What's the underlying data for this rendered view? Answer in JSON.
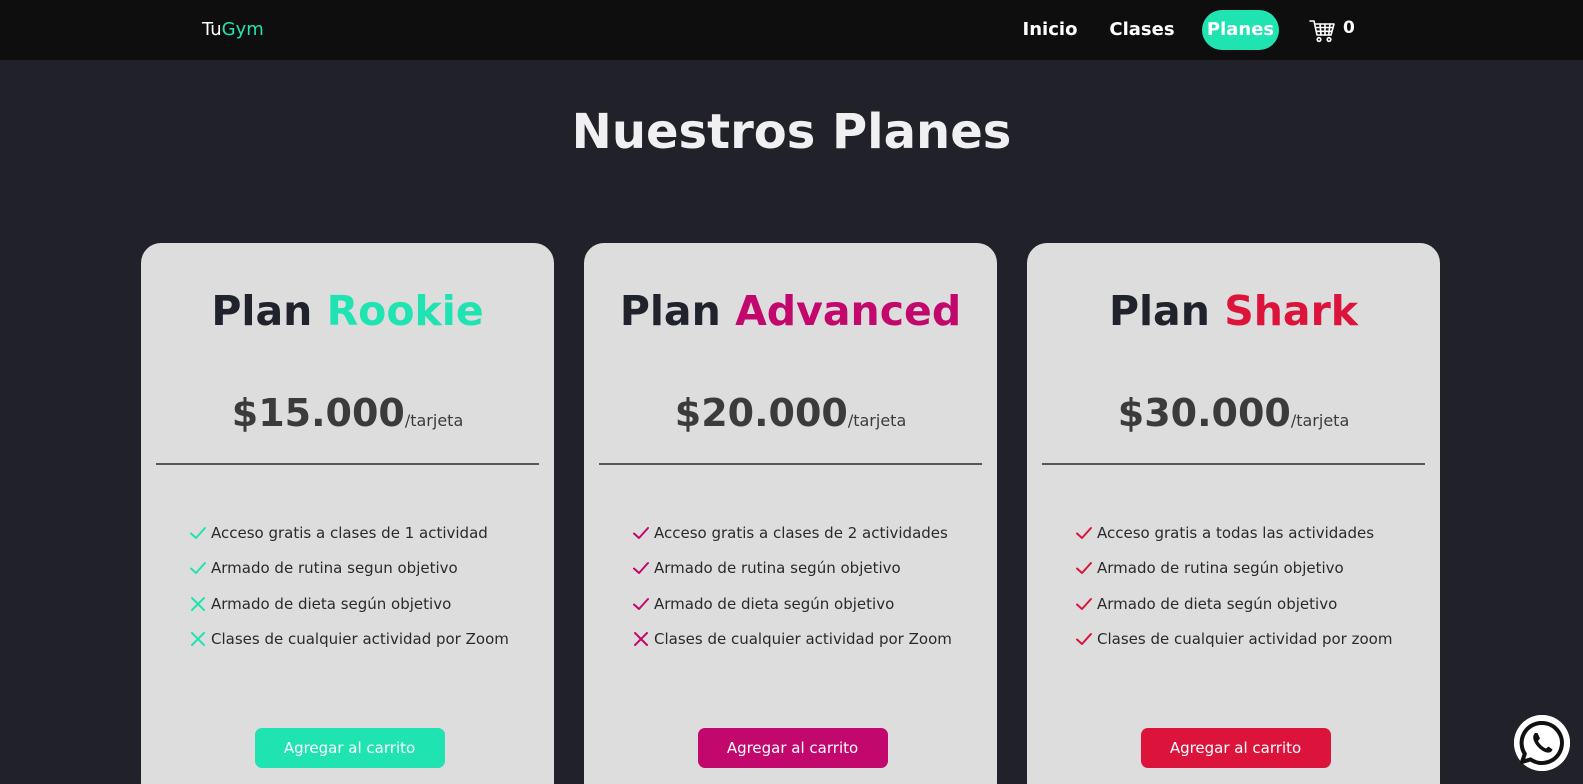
{
  "nav": {
    "brand_prefix": "Tu",
    "brand_suffix": "Gym",
    "links": [
      "Inicio",
      "Clases",
      "Planes"
    ],
    "active": "Planes",
    "cart_count": "0",
    "cart_icon": "cart-icon"
  },
  "page": {
    "title": "Nuestros Planes"
  },
  "plans": [
    {
      "prefix": "Plan",
      "name": "Rookie",
      "color": "#20e3b2",
      "price": "$15.000",
      "unit": "/tarjeta",
      "features": [
        {
          "text": "Acceso gratis a clases de 1 actividad",
          "included": true
        },
        {
          "text": "Armado de rutina segun objetivo",
          "included": true
        },
        {
          "text": "Armado de dieta según objetivo",
          "included": false
        },
        {
          "text": "Clases de cualquier actividad por Zoom",
          "included": false
        }
      ],
      "button": "Agregar al carrito"
    },
    {
      "prefix": "Plan",
      "name": "Advanced",
      "color": "#c2076d",
      "price": "$20.000",
      "unit": "/tarjeta",
      "features": [
        {
          "text": "Acceso gratis a clases de 2 actividades",
          "included": true
        },
        {
          "text": "Armado de rutina según objetivo",
          "included": true
        },
        {
          "text": "Armado de dieta según objetivo",
          "included": true
        },
        {
          "text": "Clases de cualquier actividad por Zoom",
          "included": false
        }
      ],
      "button": "Agregar al carrito"
    },
    {
      "prefix": "Plan",
      "name": "Shark",
      "color": "#dc143c",
      "price": "$30.000",
      "unit": "/tarjeta",
      "features": [
        {
          "text": "Acceso gratis a todas las actividades",
          "included": true
        },
        {
          "text": "Armado de rutina según objetivo",
          "included": true
        },
        {
          "text": "Armado de dieta según objetivo",
          "included": true
        },
        {
          "text": "Clases de cualquier actividad por zoom",
          "included": true
        }
      ],
      "button": "Agregar al carrito"
    }
  ],
  "whatsapp_icon": "whatsapp-icon",
  "colors": {
    "accent": "#20e3b2",
    "navbar_bg": "#0e0e0e",
    "page_bg": "#212229",
    "card_bg": "#dddddd"
  }
}
